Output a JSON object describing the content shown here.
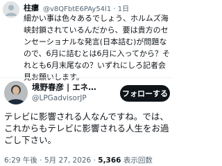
{
  "reply": {
    "name": "柱瘻",
    "handle": "@v8QFbtE6PAy54l1",
    "separator": "·",
    "time": "1日",
    "body": "細かい事は色々あるでしょう、ホルムズ海峡封鎖されているんだから、要は貴方のセンセーショナルな発言(日本詰む)が問題なので、6月に詰むとは6月に入ってから？それとも6月末尾なの？いずれにしろ記者会見お願いします。"
  },
  "author": {
    "name": "境野春彦 | エネ…",
    "handle": "@LPGadvisorJP",
    "follow_label": "フォローする"
  },
  "post": {
    "text": "テレビに影響される人なんですね。では、これからもテレビに影響される人生をお過ごし下さい。",
    "time": "6:29 午後",
    "date": "5月 27, 2026",
    "views_count": "5,366",
    "views_label": "表示回数",
    "separator": "·"
  }
}
